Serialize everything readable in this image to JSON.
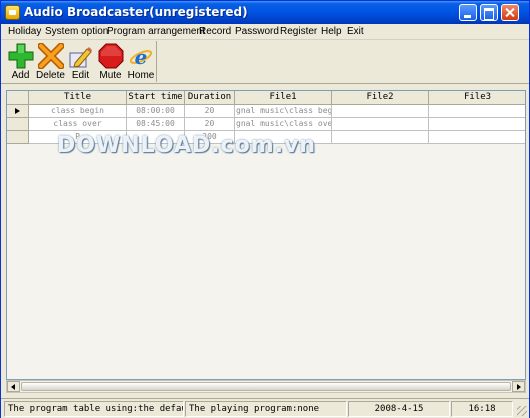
{
  "window": {
    "title": "Audio Broadcaster(unregistered)"
  },
  "menu": [
    "Holiday",
    "System option",
    "Program arrangement",
    "Record",
    "Password",
    "Register",
    "Help",
    "Exit"
  ],
  "toolbar": {
    "add": "Add",
    "delete": "Delete",
    "edit": "Edit",
    "mute": "Mute",
    "home": "Home"
  },
  "table": {
    "columns": [
      "Title",
      "Start time",
      "Duration",
      "File1",
      "File2",
      "File3"
    ],
    "rows": [
      {
        "title": "class begin",
        "start": "08:00:00",
        "duration": "20",
        "file1": "gnal music\\class beg",
        "file2": "",
        "file3": "",
        "current": true
      },
      {
        "title": "class over",
        "start": "08:45:00",
        "duration": "20",
        "file1": "gnal music\\class ove",
        "file2": "",
        "file3": "",
        "current": false
      },
      {
        "title": "P",
        "start": "",
        "duration": "200",
        "file1": "",
        "file2": "",
        "file3": "",
        "current": false
      }
    ]
  },
  "watermark": "DOWNLOAD.com.vn",
  "status": {
    "program_table": "The program table using:the default p",
    "playing": "The playing program:none",
    "date": "2008-4-15",
    "time": "16:18"
  },
  "colors": {
    "titlebar": "#0055e5",
    "window_bg": "#ece9d8"
  }
}
